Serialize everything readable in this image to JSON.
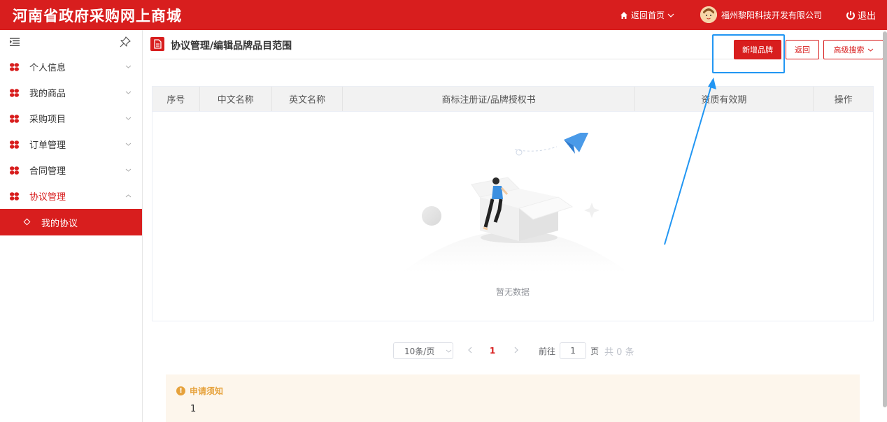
{
  "app": {
    "title": "河南省政府采购网上商城"
  },
  "header": {
    "home_label": "返回首页",
    "company": "福州黎阳科技开发有限公司",
    "logout_label": "退出"
  },
  "sidebar": {
    "items": [
      {
        "label": "个人信息"
      },
      {
        "label": "我的商品"
      },
      {
        "label": "采购项目"
      },
      {
        "label": "订单管理"
      },
      {
        "label": "合同管理"
      },
      {
        "label": "协议管理"
      }
    ],
    "sub_item": "我的协议"
  },
  "page": {
    "title": "协议管理/编辑品牌品目范围",
    "btn_new": "新增品牌",
    "btn_back": "返回",
    "btn_adv": "高级搜索"
  },
  "table": {
    "columns": [
      "序号",
      "中文名称",
      "英文名称",
      "商标注册证/品牌授权书",
      "资质有效期",
      "操作"
    ],
    "empty_text": "暂无数据"
  },
  "pager": {
    "page_size": "10条/页",
    "current": "1",
    "goto_prefix": "前往",
    "goto_value": "1",
    "goto_suffix": "页",
    "total": "共 0 条"
  },
  "notice": {
    "title": "申请须知",
    "body": "1"
  },
  "colors": {
    "brand": "#d81e1e",
    "callout": "#2196f3"
  },
  "icons": {
    "home": "home-icon",
    "logout": "power-icon",
    "menu": "menu-icon",
    "pin": "pin-icon"
  }
}
